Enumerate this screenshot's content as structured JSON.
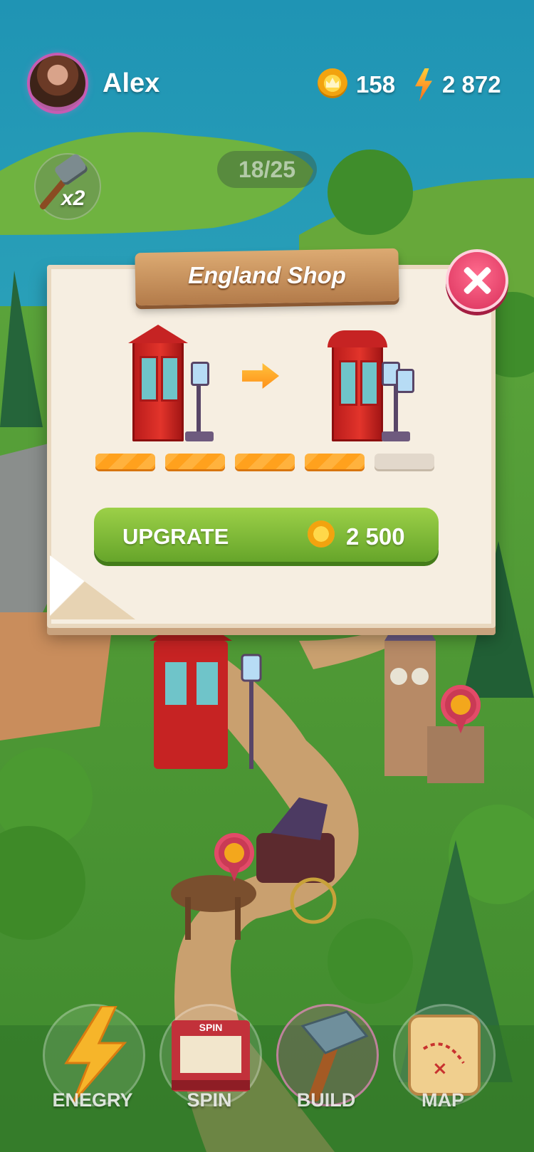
{
  "player": {
    "name": "Alex",
    "coins": "158",
    "energy": "2 872"
  },
  "boost": {
    "multiplier": "x2"
  },
  "progress": {
    "text": "18/25"
  },
  "shop": {
    "title": "England Shop",
    "upgrade_level": {
      "filled": 4,
      "total": 5
    },
    "upgrade_button": {
      "label": "UPGRATE",
      "price": "2 500"
    }
  },
  "nav": {
    "items": [
      {
        "label": "ENEGRY",
        "icon": "lightning-icon"
      },
      {
        "label": "SPIN",
        "icon": "slot-machine-icon",
        "badge": "SPIN"
      },
      {
        "label": "BUILD",
        "icon": "hammer-icon"
      },
      {
        "label": "MAP",
        "icon": "treasure-map-icon"
      }
    ]
  },
  "colors": {
    "accent_green": "#7ab93a",
    "close_red": "#e23a62",
    "progress_orange": "#ffa11d",
    "coin_gold": "#f5b21a"
  }
}
